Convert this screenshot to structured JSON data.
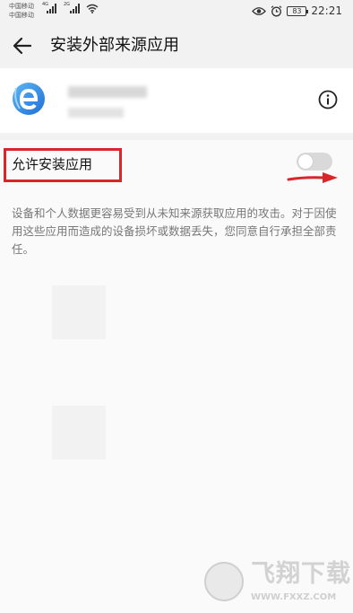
{
  "status_bar": {
    "carrier_1": "中国移动",
    "carrier_2": "中国移动",
    "net_1": "4G",
    "net_2": "2G",
    "battery": "83",
    "time": "22:21",
    "icons": [
      "eye-icon",
      "alarm-icon",
      "wifi-icon",
      "signal-icon",
      "battery-icon"
    ]
  },
  "header": {
    "title": "安装外部来源应用",
    "back_icon": "arrow-left-icon"
  },
  "app": {
    "icon": "browser-e-icon",
    "info_icon": "info-circle-icon"
  },
  "setting": {
    "label": "允许安装应用",
    "enabled": false
  },
  "description": "设备和个人数据更容易受到从未知来源获取应用的攻击。对于因使用这些应用而造成的设备损坏或数据丢失，您同意自行承担全部责任。",
  "watermark": {
    "logo_text": "飞翔下载",
    "url": "WWW.FXXZ.COM"
  },
  "colors": {
    "accent_red": "#d9262c",
    "toggle_off": "#d9d9d9",
    "app_icon_blue": "#2b8ae6"
  }
}
